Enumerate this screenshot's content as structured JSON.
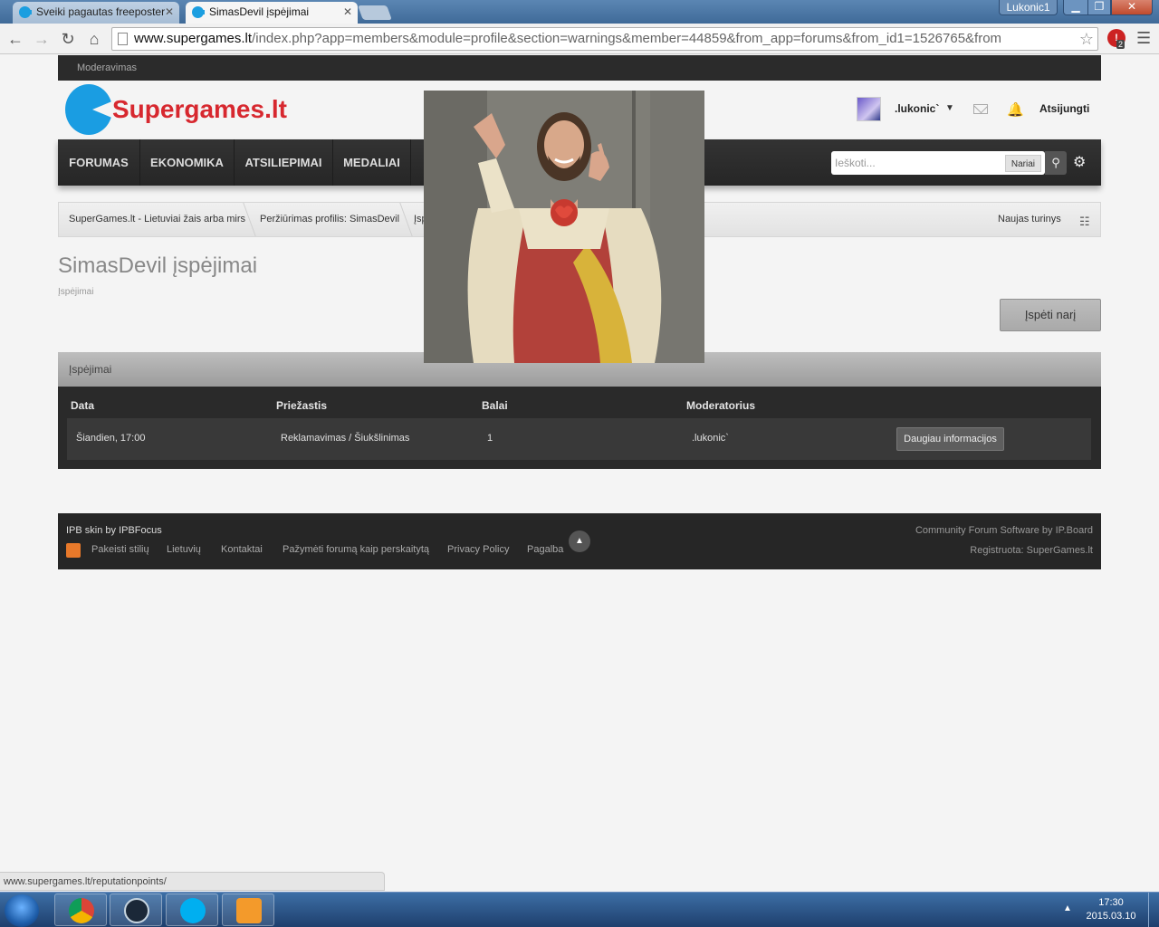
{
  "browser": {
    "tabs": [
      {
        "title": "Sveiki pagautas freeposter",
        "active": false
      },
      {
        "title": "SimasDevil įspėjimai",
        "active": true
      }
    ],
    "window_user": "Lukonic1",
    "url_domain": "www.supergames.lt",
    "url_path": "/index.php?app=members&module=profile&section=warnings&member=44859&from_app=forums&from_id1=1526765&from",
    "extension_badge": "2",
    "status_url": "www.supergames.lt/reputationpoints/"
  },
  "site": {
    "mod_bar": "Moderavimas",
    "logo_text": "Supergames.lt",
    "username": ".lukonic`",
    "logout": "Atsijungti",
    "nav": [
      "FORUMAS",
      "EKONOMIKA",
      "ATSILIEPIMAI",
      "MEDALIAI"
    ],
    "search": {
      "placeholder": "Ieškoti...",
      "scope": "Nariai"
    },
    "breadcrumb": [
      "SuperGames.lt - Lietuviai žais arba mirs",
      "Peržiūrimas profilis: SimasDevil",
      "Įsp"
    ],
    "new_content": "Naujas turinys"
  },
  "main": {
    "title": "SimasDevil įspėjimai",
    "subtitle": "Įspėjimai",
    "warn_button": "Įspėti narį",
    "panel_title": "Įspėjimai",
    "columns": [
      "Data",
      "Priežastis",
      "Balai",
      "Moderatorius"
    ],
    "rows": [
      {
        "date": "Šiandien, 17:00",
        "reason": "Reklamavimas / Šiukšlinimas",
        "points": "1",
        "moderator": ".lukonic`",
        "action": "Daugiau informacijos"
      }
    ]
  },
  "footer": {
    "credit": "IPB skin by IPBFocus",
    "links": [
      "Pakeisti stilių",
      "Lietuvių",
      "Kontaktai",
      "Pažymėti forumą kaip perskaitytą",
      "Privacy Policy",
      "Pagalba"
    ],
    "right_1": "Community Forum Software by IP.Board",
    "right_2": "Registruota: SuperGames.lt"
  },
  "taskbar": {
    "time": "17:30",
    "date": "2015.03.10"
  },
  "colors": {
    "brand_red": "#d7282f",
    "brand_blue": "#1a9de2",
    "nav_dark": "#2b2b2b"
  }
}
